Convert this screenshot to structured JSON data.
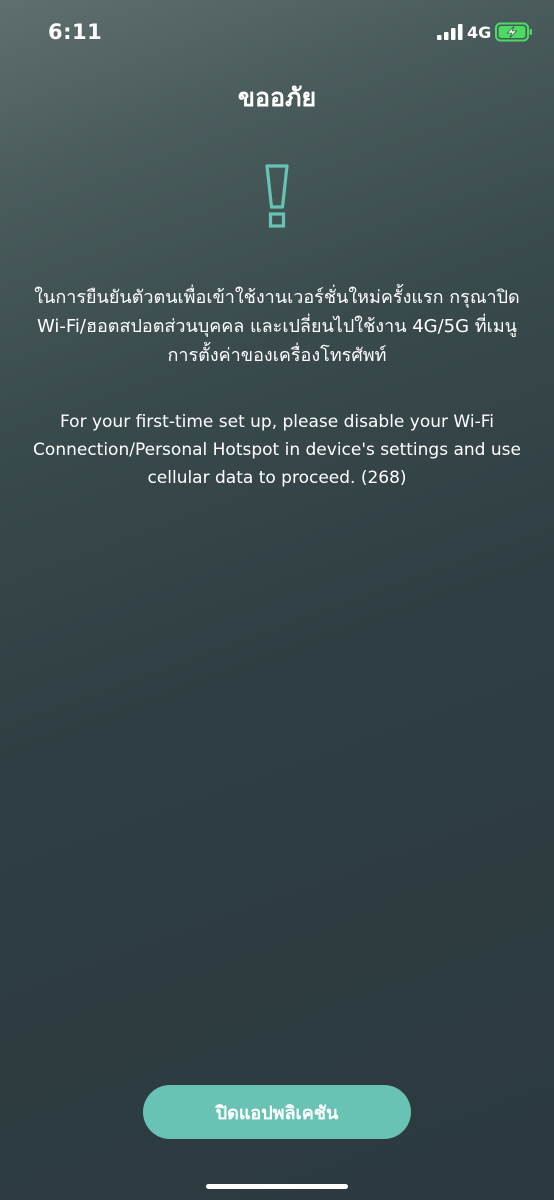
{
  "status_bar": {
    "time": "6:11",
    "network": "4G",
    "battery_color": "#4cd964"
  },
  "dialog": {
    "title": "ขออภัย",
    "message_th": "ในการยืนยันตัวตนเพื่อเข้าใช้งานเวอร์ชั่นใหม่ครั้งแรก กรุณาปิด Wi-Fi/ฮอตสปอตส่วนบุคคล และเปลี่ยนไปใช้งาน 4G/5G ที่เมนูการตั้งค่าของเครื่องโทรศัพท์",
    "message_en": "For your first-time set up, please disable your Wi-Fi Connection/Personal Hotspot in device's settings and use cellular data to proceed. (268)",
    "icon": "exclamation-outline-icon",
    "accent_color": "#69c3b4"
  },
  "actions": {
    "close_app_label": "ปิดแอปพลิเคชัน"
  }
}
